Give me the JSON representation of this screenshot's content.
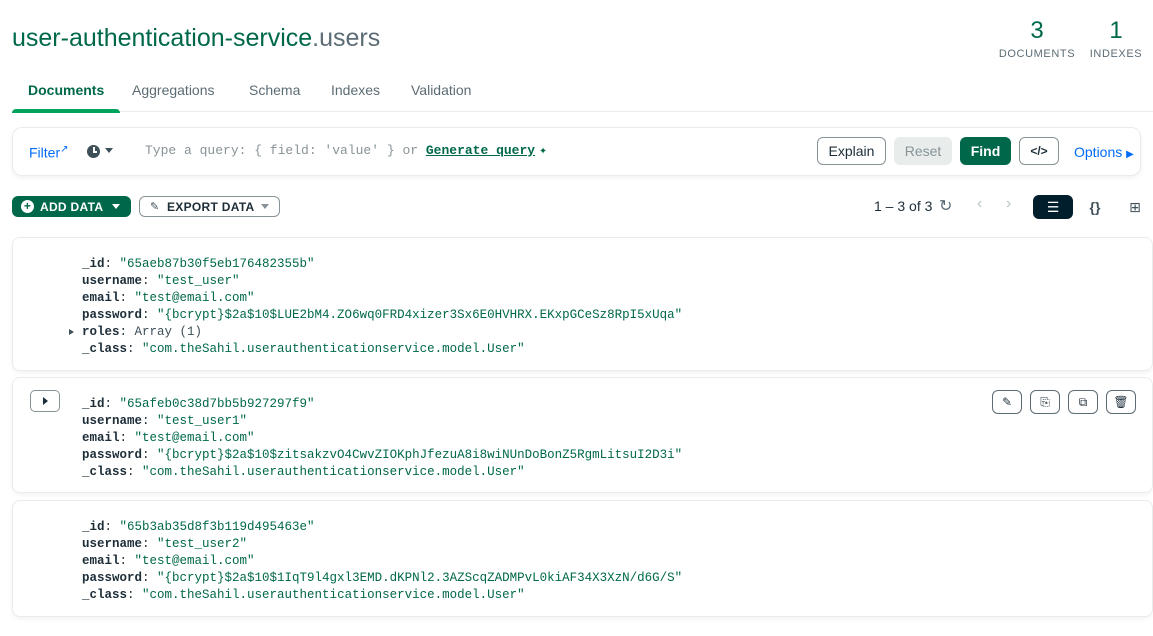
{
  "header": {
    "db_name": "user-authentication-service",
    "coll_name": ".users",
    "documents_count": "3",
    "documents_label": "DOCUMENTS",
    "indexes_count": "1",
    "indexes_label": "INDEXES"
  },
  "tabs": [
    {
      "label": "Documents",
      "active": true
    },
    {
      "label": "Aggregations"
    },
    {
      "label": "Schema"
    },
    {
      "label": "Indexes"
    },
    {
      "label": "Validation"
    }
  ],
  "query_bar": {
    "filter_label": "Filter",
    "placeholder": "Type a query: { field: 'value' } or",
    "generate_label": "Generate query",
    "explain": "Explain",
    "reset": "Reset",
    "find": "Find",
    "options": "Options"
  },
  "toolbar": {
    "add_data": "ADD DATA",
    "export_data": "EXPORT DATA",
    "pagination": "1 – 3 of 3"
  },
  "documents": [
    {
      "fields": [
        {
          "key": "_id",
          "value": "\"65aeb87b30f5eb176482355b\""
        },
        {
          "key": "username",
          "value": "\"test_user\""
        },
        {
          "key": "email",
          "value": "\"test@email.com\""
        },
        {
          "key": "password",
          "value": "\"{bcrypt}$2a$10$LUE2bM4.ZO6wq0FRD4xizer3Sx6E0HVHRX.EKxpGCeSz8RpI5xUqa\""
        },
        {
          "key": "roles",
          "value": "Array (1)"
        },
        {
          "key": "_class",
          "value": "\"com.theSahil.userauthenticationservice.model.User\""
        }
      ]
    },
    {
      "fields": [
        {
          "key": "_id",
          "value": "\"65afeb0c38d7bb5b927297f9\""
        },
        {
          "key": "username",
          "value": "\"test_user1\""
        },
        {
          "key": "email",
          "value": "\"test@email.com\""
        },
        {
          "key": "password",
          "value": "\"{bcrypt}$2a$10$zitsakzvO4CwvZIOKphJfezuA8i8wiNUnDoBonZ5RgmLitsuI2D3i\""
        },
        {
          "key": "_class",
          "value": "\"com.theSahil.userauthenticationservice.model.User\""
        }
      ]
    },
    {
      "fields": [
        {
          "key": "_id",
          "value": "\"65b3ab35d8f3b119d495463e\""
        },
        {
          "key": "username",
          "value": "\"test_user2\""
        },
        {
          "key": "email",
          "value": "\"test@email.com\""
        },
        {
          "key": "password",
          "value": "\"{bcrypt}$2a$10$1IqT9l4gxl3EMD.dKPNl2.3AZScqZADMPvL0kiAF34X3XzN/d6G/S\""
        },
        {
          "key": "_class",
          "value": "\"com.theSahil.userauthenticationservice.model.User\""
        }
      ]
    }
  ],
  "colors": {
    "brand_green": "#00684a",
    "link_blue": "#016bf8",
    "dark": "#001e2b"
  },
  "icons": [
    "external-link-icon",
    "clock-icon",
    "sparkle-icon",
    "code-icon",
    "plus-circle-icon",
    "export-icon",
    "refresh-icon",
    "chevron-left-icon",
    "chevron-right-icon",
    "list-view-icon",
    "json-view-icon",
    "table-view-icon",
    "pencil-icon",
    "copy-icon",
    "clone-icon",
    "trash-icon",
    "expand-icon"
  ]
}
